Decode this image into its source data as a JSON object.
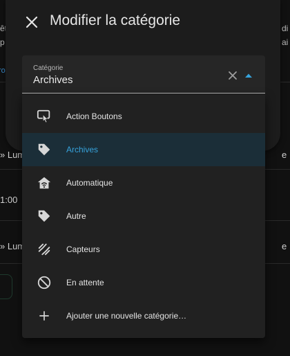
{
  "background": {
    "frag_left_top": "êt",
    "frag_left_second": "p",
    "frag_right_top": "di",
    "frag_right_second": "ai",
    "frag_blue": "ro",
    "row1": "» Lum",
    "row2": "1:00",
    "row3": "» Lum",
    "row1_right": "e",
    "row3_right": "e"
  },
  "dialog": {
    "title": "Modifier la catégorie",
    "close_icon": "close-icon"
  },
  "field": {
    "label": "Catégorie",
    "value": "Archives",
    "clear_icon": "close-icon",
    "arrow_icon": "caret-up-icon"
  },
  "menu": {
    "items": [
      {
        "label": "Action Boutons",
        "icon": "gesture-tap-icon",
        "selected": false
      },
      {
        "label": "Archives",
        "icon": "tag-icon",
        "selected": true
      },
      {
        "label": "Automatique",
        "icon": "home-automation-icon",
        "selected": false
      },
      {
        "label": "Autre",
        "icon": "tag-icon",
        "selected": false
      },
      {
        "label": "Capteurs",
        "icon": "sensor-icon",
        "selected": false
      },
      {
        "label": "En attente",
        "icon": "cancel-icon",
        "selected": false
      },
      {
        "label": "Ajouter une nouvelle catégorie…",
        "icon": "plus-icon",
        "selected": false
      }
    ]
  },
  "colors": {
    "accent": "#36a3dc",
    "selected_bg": "#1b2e38",
    "surface": "#212121",
    "dialog": "#1c1c1c"
  }
}
